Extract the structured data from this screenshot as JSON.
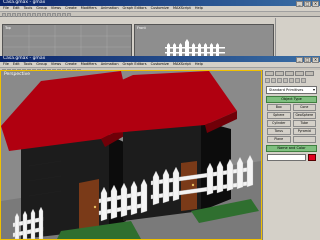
{
  "back_window": {
    "title": "Casa.gmax - gmax",
    "menu": [
      "File",
      "Edit",
      "Tools",
      "Group",
      "Views",
      "Create",
      "Modifiers",
      "Animation",
      "Graph Editors",
      "Customize",
      "MAXScript",
      "Help"
    ],
    "viewports": [
      "Top",
      "Front"
    ]
  },
  "front_window": {
    "title": "Casa.gmax - gmax",
    "menu": [
      "File",
      "Edit",
      "Tools",
      "Group",
      "Views",
      "Create",
      "Modifiers",
      "Animation",
      "Graph Editors",
      "Customize",
      "MAXScript",
      "Help"
    ],
    "viewport_label": "Perspective",
    "panel": {
      "dropdown": "Standard Primitives",
      "object_type_header": "Object Type",
      "primitives": [
        "Box",
        "Cone",
        "Sphere",
        "GeoSphere",
        "Cylinder",
        "Tube",
        "Torus",
        "Pyramid",
        "Plane",
        ""
      ],
      "name_color_header": "Name and Color"
    }
  },
  "colors": {
    "roof": "#b00010",
    "wall": "#1c1c1c",
    "door": "#7a3a18",
    "fence": "#f4f4f4",
    "ground": "#2f6f2f",
    "selected_border": "#f0c000"
  }
}
